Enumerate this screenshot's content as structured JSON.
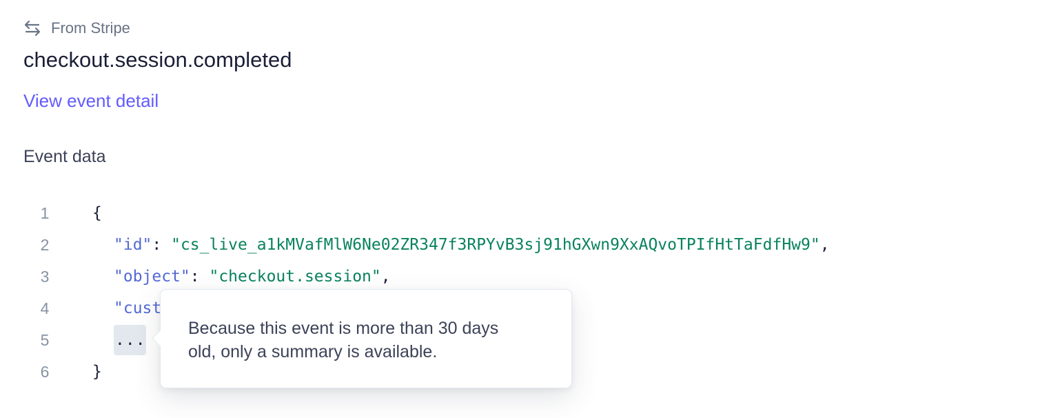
{
  "header": {
    "source_icon": "arrows-swap-icon",
    "source_label": "From Stripe",
    "event_type": "checkout.session.completed",
    "view_detail_link": "View event detail"
  },
  "event_data": {
    "heading": "Event data",
    "lines": [
      {
        "number": "1",
        "open_brace": "{"
      },
      {
        "number": "2",
        "key": "\"id\"",
        "separator": ": ",
        "value": "\"cs_live_a1kMVafMlW6Ne02ZR347f3RPYvB3sj91hGXwn9XxAQvoTPIfHtTaFdfHw9\"",
        "trailing": ","
      },
      {
        "number": "3",
        "key": "\"object\"",
        "separator": ": ",
        "value": "\"checkout.session\"",
        "trailing": ","
      },
      {
        "number": "4",
        "key": "\"cust",
        "separator": "",
        "value": "",
        "trailing": ""
      },
      {
        "number": "5",
        "ellipsis": "..."
      },
      {
        "number": "6",
        "close_brace": "}"
      }
    ]
  },
  "tooltip": {
    "text": "Because this event is more than 30 days old, only a summary is available."
  },
  "colors": {
    "link": "#635bff",
    "json_key": "#5469d4",
    "json_string": "#09825d",
    "line_number": "#8792a2"
  }
}
